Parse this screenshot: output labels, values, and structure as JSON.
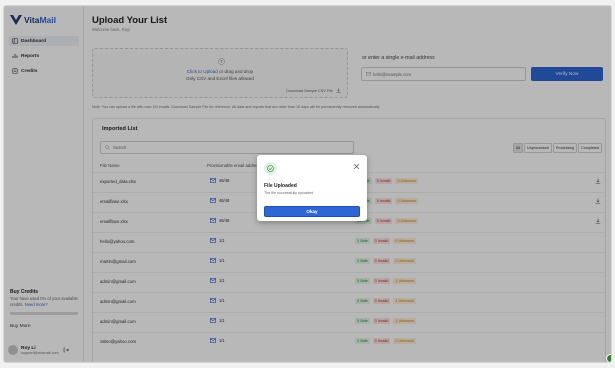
{
  "app": {
    "logo_text_a": "Vita",
    "logo_text_b": "Mail",
    "brand_color": "#2f66d6"
  },
  "sidebar": {
    "items": [
      {
        "label": "Dashboard",
        "icon": "dashboard-icon"
      },
      {
        "label": "Reports",
        "icon": "reports-icon"
      },
      {
        "label": "Credits",
        "icon": "credits-icon"
      }
    ],
    "credits": {
      "title": "Buy Credits",
      "text": "Your have used 0% of your available credits.",
      "link": "Need more?",
      "used_fraction": 0
    },
    "buy_more": "Buy More",
    "user": {
      "name": "Roy Li",
      "email": "support@vitamail.com"
    }
  },
  "main": {
    "title": "Upload Your List",
    "subtitle": "Welcome back, Roy!",
    "upload": {
      "link": "Click to Upload",
      "line1_rest": " or drag and drop",
      "line2": "Only CSV and Excel files allowed",
      "sample": "Download Sample CSV File"
    },
    "single_email": {
      "label": "or enter a single e-mail address",
      "placeholder": "hello@example.com",
      "button": "Verify Now"
    },
    "note": "Note: You can upload a file with max 1M emails. Download Sample File for reference. All data and reports that are older than 15 days will be permanently removed automatically.",
    "imported": {
      "title": "Imported List",
      "search_placeholder": "Search",
      "filters": [
        "All",
        "Unprocessed",
        "Processing",
        "Completed"
      ],
      "columns": {
        "file": "File Name",
        "provider": "Provisionable email addresses"
      },
      "rows": [
        {
          "file": "exported_data.xlsx",
          "count": "48/48",
          "safe": "45 Safe",
          "invalid": "0 Invalid",
          "unknown": "0 Unknown"
        },
        {
          "file": "emailflase.xlsx",
          "count": "48/48",
          "safe": "45 Safe",
          "invalid": "0 Invalid",
          "unknown": "0 Unknown"
        },
        {
          "file": "emailflase.xlsx",
          "count": "48/48",
          "safe": "45 Safe",
          "invalid": "0 Invalid",
          "unknown": "0 Unknown"
        },
        {
          "file": "hello@yahoo.com",
          "count": "1/1",
          "safe": "1 Safe",
          "invalid": "0 Invalid",
          "unknown": "0 Unknown"
        },
        {
          "file": "martin@gmail.com",
          "count": "1/1",
          "safe": "1 Safe",
          "invalid": "0 Invalid",
          "unknown": "0 Unknown"
        },
        {
          "file": "admin@gmail.com",
          "count": "1/1",
          "safe": "0 Safe",
          "invalid": "0 Invalid",
          "unknown": "1 Unknown"
        },
        {
          "file": "admin@gmail.com",
          "count": "1/1",
          "safe": "0 Safe",
          "invalid": "0 Invalid",
          "unknown": "1 Unknown"
        },
        {
          "file": "admin@gmail.com",
          "count": "1/1",
          "safe": "0 Safe",
          "invalid": "0 Invalid",
          "unknown": "1 Unknown"
        },
        {
          "file": "zabro@yahoo.com",
          "count": "1/1",
          "safe": "1 Safe",
          "invalid": "0 Invalid",
          "unknown": "0 Unknown"
        }
      ]
    }
  },
  "modal": {
    "title": "File Uploaded",
    "text": "The file successfully uploaded",
    "button": "Okay"
  }
}
